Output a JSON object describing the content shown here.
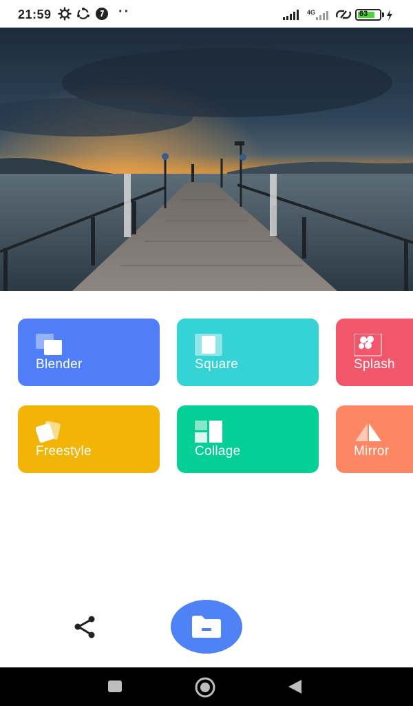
{
  "status_bar": {
    "time": "21:59",
    "network": "4G",
    "battery": "63",
    "icons": [
      "gear-icon",
      "sync-icon",
      "notification-badge-icon",
      "more-dots-icon",
      "signal-icon",
      "hotspot-icon",
      "battery-icon",
      "charging-icon"
    ]
  },
  "hero": {
    "icon": "pier-photo"
  },
  "tiles": [
    {
      "label": "Blender",
      "color": "#4f7ef8",
      "icon": "blender-icon"
    },
    {
      "label": "Square",
      "color": "#35d2d6",
      "icon": "square-icon"
    },
    {
      "label": "Splash",
      "color": "#f2566a",
      "icon": "splash-icon"
    },
    {
      "label": "Freestyle",
      "color": "#f2b407",
      "icon": "freestyle-icon"
    },
    {
      "label": "Collage",
      "color": "#04cf96",
      "icon": "collage-icon"
    },
    {
      "label": "Mirror",
      "color": "#fc8762",
      "icon": "mirror-icon"
    }
  ],
  "actions": {
    "share_icon": "share-icon",
    "fab_icon": "folder-icon",
    "fab_color": "#4f83f5"
  },
  "nav": {
    "icons": [
      "recents-icon",
      "home-icon",
      "back-icon"
    ]
  }
}
